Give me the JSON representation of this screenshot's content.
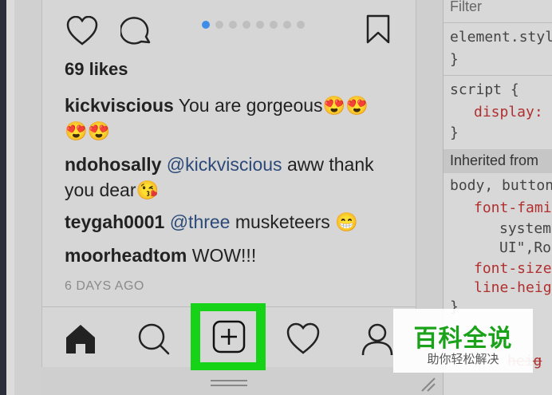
{
  "post": {
    "carousel": {
      "count": 8,
      "active_index": 0
    },
    "likes": "69 likes",
    "comments": [
      {
        "user": "kickviscious",
        "text": " You are gorgeous😍😍",
        "text2": "😍😍"
      },
      {
        "user": "ndohosally",
        "mention": "@kickviscious",
        "text": " aww thank",
        "text2": "you dear😘"
      },
      {
        "user": "teygah0001",
        "mention": "@three",
        "text": " musketeers 😁"
      },
      {
        "user": "moorheadtom",
        "text": " WOW!!!"
      }
    ],
    "timestamp": "6 DAYS AGO"
  },
  "devtools": {
    "filter": "Filter",
    "lines": [
      "element.styl",
      "}",
      "script {",
      "display:",
      "}",
      "body, button",
      "font-fami",
      "system",
      "UI\",Ro",
      "font-size",
      "line-heig",
      "}",
      "heig"
    ],
    "inherited": "Inherited from"
  },
  "watermark": {
    "title": "百科全说",
    "subtitle": "助你轻松解决"
  },
  "colors": {
    "highlight": "#17d317",
    "accent": "#3d8de8",
    "watermark_green": "#1aa31a"
  },
  "icons": [
    "heart-icon",
    "comment-icon",
    "bookmark-icon",
    "home-icon",
    "search-icon",
    "add-post-icon",
    "activity-heart-icon",
    "profile-icon"
  ]
}
